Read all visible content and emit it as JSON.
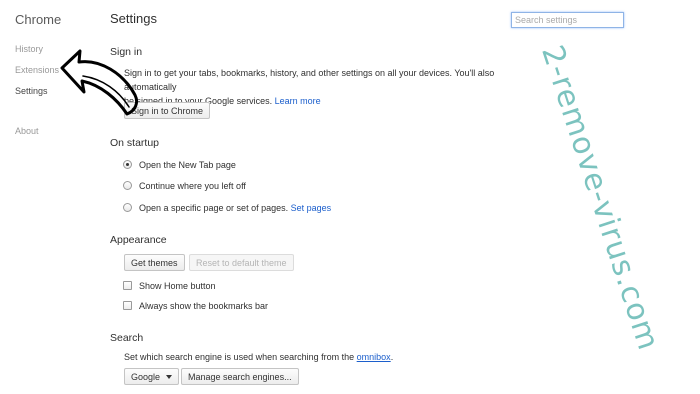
{
  "nav": {
    "title": "Chrome",
    "items": [
      {
        "label": "History"
      },
      {
        "label": "Extensions"
      },
      {
        "label": "Settings"
      },
      {
        "label": "About"
      }
    ]
  },
  "page": {
    "title": "Settings",
    "search_placeholder": "Search settings"
  },
  "signin": {
    "heading": "Sign in",
    "text_part1": "Sign in to get your tabs, bookmarks, history, and other settings on all your devices. You'll also automatically",
    "text_part2": "be signed in to your Google services.",
    "learn_more": "Learn more",
    "button": "Sign in to Chrome"
  },
  "startup": {
    "heading": "On startup",
    "options": [
      {
        "label": "Open the New Tab page",
        "checked": true
      },
      {
        "label": "Continue where you left off",
        "checked": false
      },
      {
        "label": "Open a specific page or set of pages.",
        "checked": false
      }
    ],
    "set_pages_link": "Set pages"
  },
  "appearance": {
    "heading": "Appearance",
    "get_themes": "Get themes",
    "reset_theme": "Reset to default theme",
    "show_home": "Show Home button",
    "show_bookmarks": "Always show the bookmarks bar"
  },
  "search": {
    "heading": "Search",
    "text": "Set which search engine is used when searching from the",
    "omnibox_link": "omnibox",
    "text_end": ".",
    "engine": "Google",
    "manage_button": "Manage search engines..."
  },
  "watermark": "2-remove-virus.com",
  "annotation": {
    "arrow_color": "#000000"
  }
}
